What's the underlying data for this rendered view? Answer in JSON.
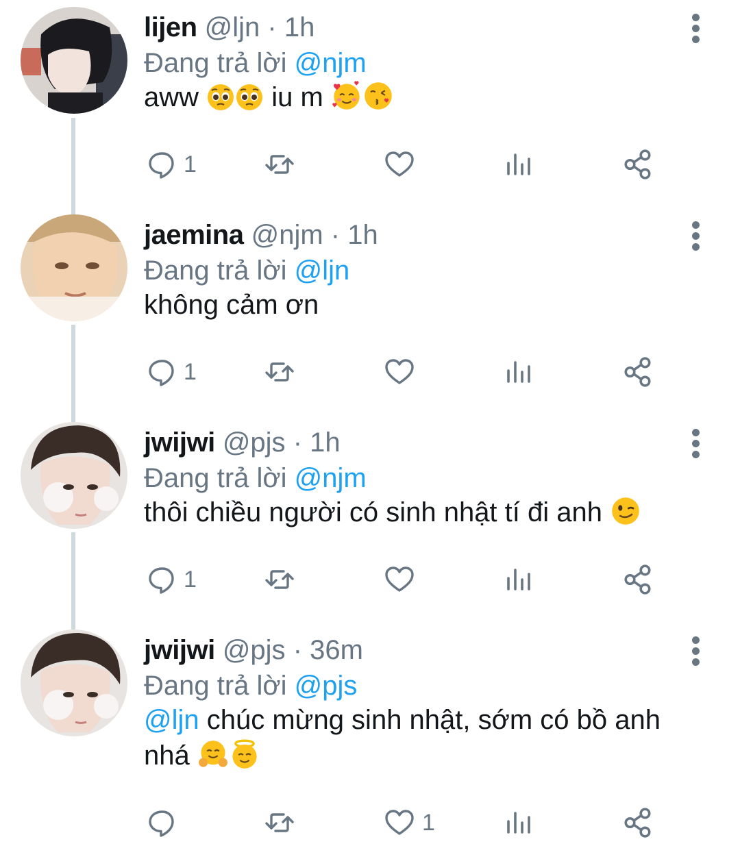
{
  "tweets": [
    {
      "name": "lijen",
      "handle": "@ljn",
      "dot": "·",
      "time": "1h",
      "reply_prefix": "Đang trả lời",
      "reply_to": "@njm",
      "text_1": "aww",
      "text_2": "iu m",
      "reply_count": "1",
      "like_count": ""
    },
    {
      "name": "jaemina",
      "handle": "@njm",
      "dot": "·",
      "time": "1h",
      "reply_prefix": "Đang trả lời",
      "reply_to": "@ljn",
      "text_1": "không cảm ơn",
      "reply_count": "1",
      "like_count": ""
    },
    {
      "name": "jwijwi",
      "handle": "@pjs",
      "dot": "·",
      "time": "1h",
      "reply_prefix": "Đang trả lời",
      "reply_to": "@njm",
      "text_1": "thôi chiều người có sinh nhật tí đi anh",
      "reply_count": "1",
      "like_count": ""
    },
    {
      "name": "jwijwi",
      "handle": "@pjs",
      "dot": "·",
      "time": "36m",
      "reply_prefix": "Đang trả lời",
      "reply_to": "@pjs",
      "mention": "@ljn",
      "text_1": "chúc mừng sinh nhật, sớm có bồ anh",
      "text_2": "nhá",
      "reply_count": "",
      "like_count": "1"
    }
  ],
  "colors": {
    "link": "#1da1f2",
    "muted": "#687684",
    "thread_line": "#cfd9de",
    "text": "#14171a"
  },
  "icons": [
    "reply-icon",
    "retweet-icon",
    "like-icon",
    "analytics-icon",
    "share-icon",
    "more-options-icon"
  ]
}
